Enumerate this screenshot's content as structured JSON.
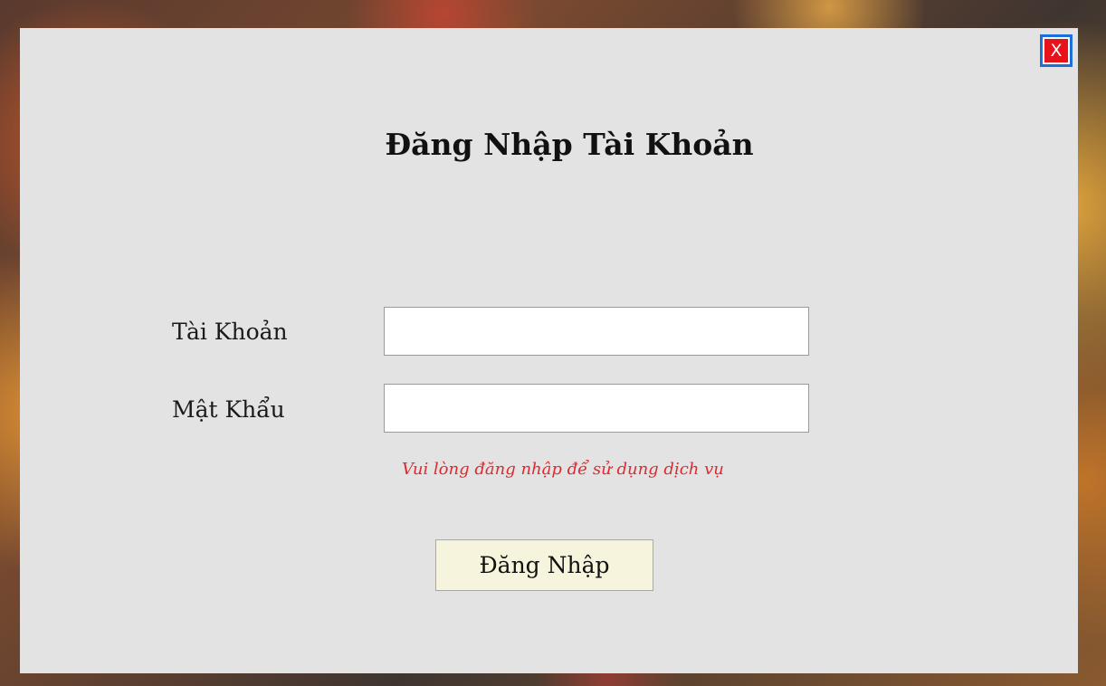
{
  "dialog": {
    "title": "Đăng Nhập Tài Khoản",
    "close_label": "X"
  },
  "form": {
    "username_label": "Tài Khoản",
    "username_value": "",
    "password_label": "Mật Khẩu",
    "password_value": "",
    "hint": "Vui lòng đăng nhập để sử dụng dịch vụ",
    "submit_label": "Đăng Nhập"
  },
  "colors": {
    "dialog_background": "#e3e3e3",
    "close_button": "#e8121b",
    "close_border": "#1e6fd9",
    "hint_text": "#e0282e",
    "submit_background": "#f6f4dd"
  }
}
